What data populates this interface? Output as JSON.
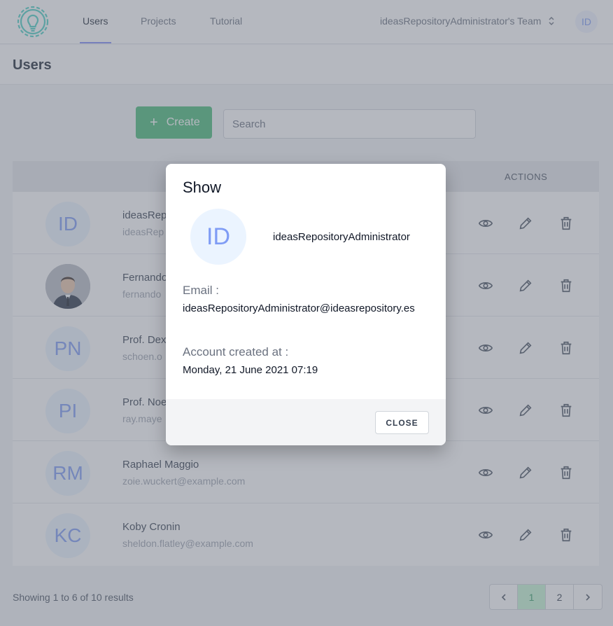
{
  "nav": {
    "links": [
      "Users",
      "Projects",
      "Tutorial"
    ],
    "team": "ideasRepositoryAdministrator's Team",
    "avatar_initials": "ID"
  },
  "header": {
    "title": "Users"
  },
  "toolbar": {
    "create_label": "Create",
    "create_icon": "+",
    "search_placeholder": "Search"
  },
  "table": {
    "actions_header": "ACTIONS",
    "rows": [
      {
        "initials": "ID",
        "name": "ideasRep",
        "email": "ideasRep"
      },
      {
        "initials": "",
        "name": "Fernando",
        "email": "fernando"
      },
      {
        "initials": "PN",
        "name": "Prof. Dex",
        "email": "schoen.o"
      },
      {
        "initials": "PI",
        "name": "Prof. Noe",
        "email": "ray.maye"
      },
      {
        "initials": "RM",
        "name": "Raphael Maggio",
        "email": "zoie.wuckert@example.com"
      },
      {
        "initials": "KC",
        "name": "Koby Cronin",
        "email": "sheldon.flatley@example.com"
      }
    ]
  },
  "footer": {
    "showing": "Showing 1 to 6 of 10 results",
    "pages": [
      "1",
      "2"
    ]
  },
  "modal": {
    "title": "Show",
    "avatar_initials": "ID",
    "name": "ideasRepositoryAdministrator",
    "email_label": "Email :",
    "email": "ideasRepositoryAdministrator@ideasrepository.es",
    "created_label": "Account created at :",
    "created": "Monday, 21 June 2021 07:19",
    "close_label": "CLOSE"
  },
  "colors": {
    "accent": "#818cf8",
    "create": "#48bb78",
    "avatar_text": "#7f9cf5"
  },
  "icons": [
    "lightbulb-gear-logo",
    "selector-chevron-icon",
    "plus-icon",
    "eye-icon",
    "pencil-icon",
    "trash-icon",
    "chevron-left-icon",
    "chevron-right-icon"
  ]
}
